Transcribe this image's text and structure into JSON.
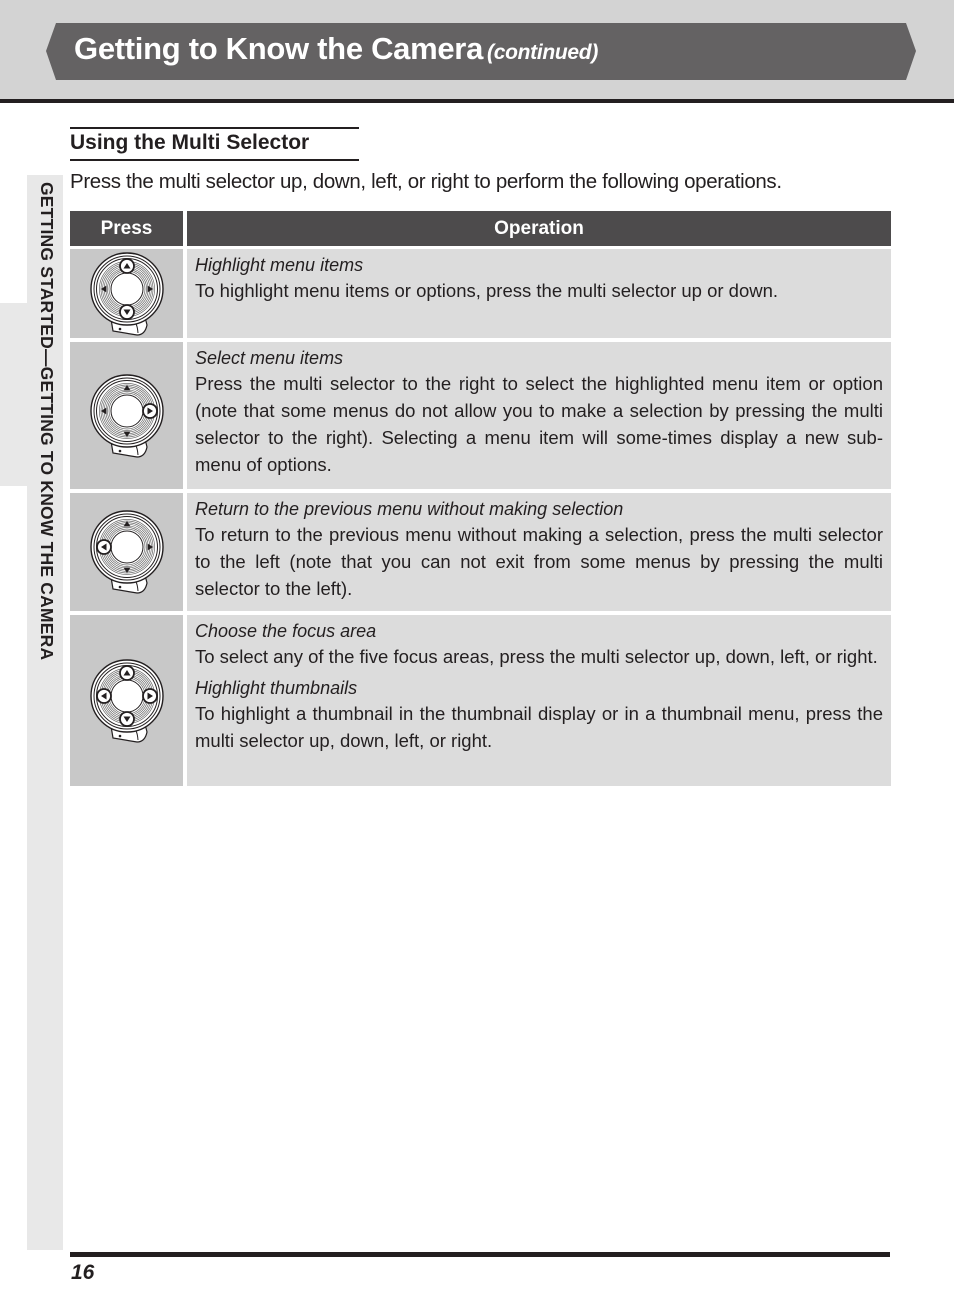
{
  "header": {
    "title": "Getting to Know the Camera",
    "subtitle": "(continued)"
  },
  "side_tab": {
    "text": "GETTING STARTED—GETTING TO KNOW THE CAMERA"
  },
  "section": {
    "heading": "Using the Multi Selector",
    "intro": "Press the multi selector up, down, left, or right to perform the following operations."
  },
  "table": {
    "headers": {
      "press": "Press",
      "operation": "Operation"
    },
    "rows": [
      {
        "icon": "multi-selector-up-down-icon",
        "highlight": [
          "up",
          "down"
        ],
        "entries": [
          {
            "label": "Highlight menu items",
            "description": "To highlight menu items or options, press the multi selector up or down."
          }
        ]
      },
      {
        "icon": "multi-selector-right-icon",
        "highlight": [
          "right"
        ],
        "entries": [
          {
            "label": "Select menu items",
            "description": "Press the multi selector to the right to select the highlighted menu item or option (note that some menus do not allow you to make a selection by pressing the multi selector to the right).  Selecting a menu item will some-times display a new sub-menu of options."
          }
        ]
      },
      {
        "icon": "multi-selector-left-icon",
        "highlight": [
          "left"
        ],
        "entries": [
          {
            "label": "Return to the previous menu without making selection",
            "description": "To return to the previous menu without making a selection, press the multi selector to the left (note that you can not exit from some menus by pressing the multi selector to the left)."
          }
        ]
      },
      {
        "icon": "multi-selector-all-directions-icon",
        "highlight": [
          "up",
          "down",
          "left",
          "right"
        ],
        "entries": [
          {
            "label": "Choose the focus area",
            "description": "To select any of the five focus areas, press the multi selector up, down, left, or right."
          },
          {
            "label": "Highlight thumbnails",
            "description": "To highlight a thumbnail in the thumbnail display or in a thumbnail menu, press the multi selector up, down, left, or right."
          }
        ]
      }
    ]
  },
  "footer": {
    "page_number": "16"
  }
}
